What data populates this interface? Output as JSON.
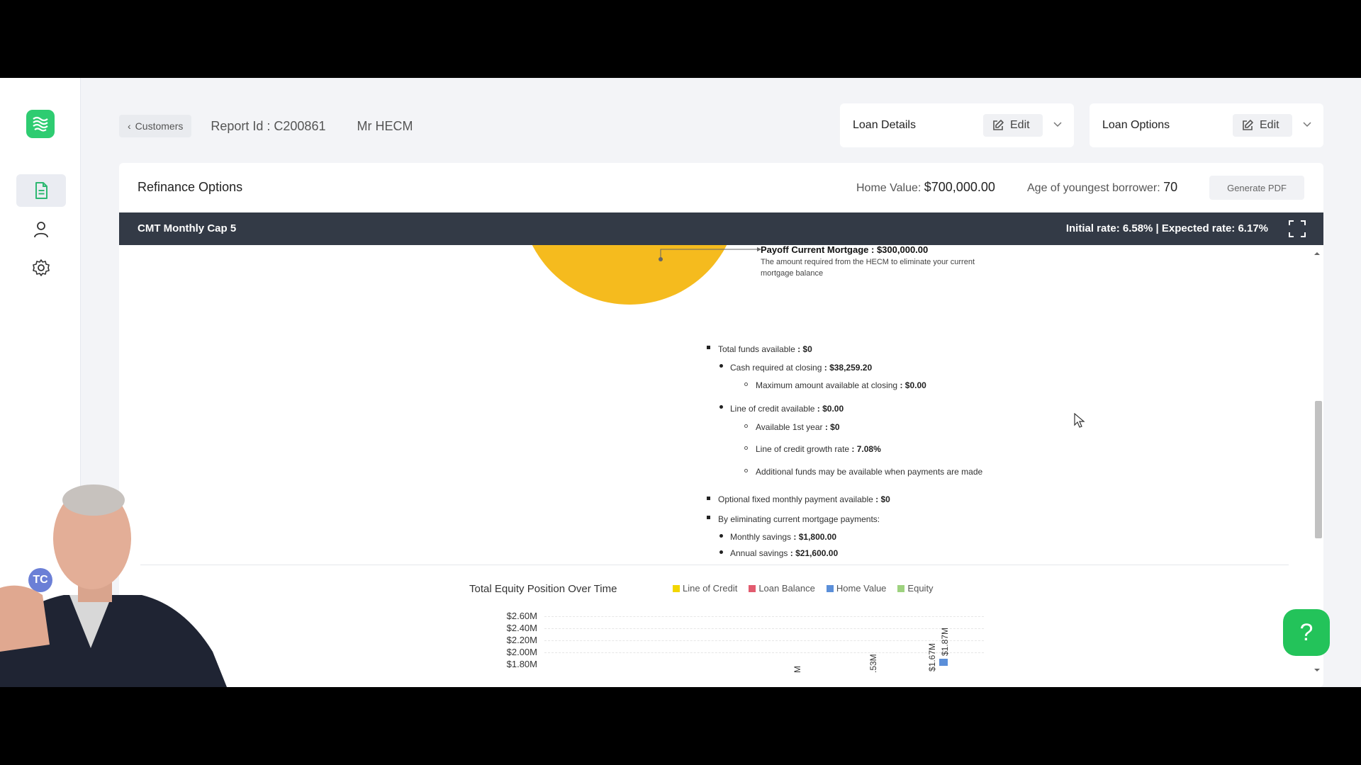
{
  "nav": {
    "back_label": "Customers",
    "report_id": "Report Id : C200861",
    "customer_name": "Mr HECM",
    "user_initials": "TC"
  },
  "loan_details": {
    "title": "Loan Details",
    "edit_label": "Edit"
  },
  "loan_options": {
    "title": "Loan Options",
    "edit_label": "Edit"
  },
  "panel": {
    "title": "Refinance Options",
    "home_value_label": "Home Value:",
    "home_value": "$700,000.00",
    "age_label": "Age of youngest borrower:",
    "age_value": "70",
    "generate_pdf_label": "Generate PDF"
  },
  "strategy": {
    "name": "CMT Monthly Cap 5",
    "rates": "Initial rate: 6.58% | Expected rate: 6.17%"
  },
  "payoff": {
    "label": "Payoff Current Mortgage : $300,000.00",
    "description": "The amount required from the HECM to eliminate your current mortgage balance"
  },
  "details": [
    {
      "label": "Total funds available",
      "value": ": $0"
    },
    {
      "label": "Cash required at closing",
      "value": ": $38,259.20"
    },
    {
      "label": "Maximum amount available at closing",
      "value": ": $0.00"
    },
    {
      "label": "Line of credit available",
      "value": ": $0.00"
    },
    {
      "label": "Available 1st year",
      "value": ": $0"
    },
    {
      "label": "Line of credit growth rate",
      "value": ": 7.08%"
    },
    {
      "label": "Additional funds may be available when payments are made",
      "value": ""
    },
    {
      "label": "Optional fixed monthly payment available",
      "value": ": $0"
    },
    {
      "label": "By eliminating current mortgage payments:",
      "value": ""
    },
    {
      "label": "Monthly savings",
      "value": ": $1,800.00"
    },
    {
      "label": "Annual savings",
      "value": ": $21,600.00"
    }
  ],
  "chart": {
    "title": "Total Equity Position Over Time",
    "legend": [
      {
        "name": "Line of Credit",
        "color": "#f2d600"
      },
      {
        "name": "Loan Balance",
        "color": "#e25b6f"
      },
      {
        "name": "Home Value",
        "color": "#5b8fd9"
      },
      {
        "name": "Equity",
        "color": "#9ed27f"
      }
    ],
    "y_ticks": [
      "$2.60M",
      "$2.40M",
      "$2.20M",
      "$2.00M",
      "$1.80M"
    ],
    "bar_labels": [
      "M",
      ".53M",
      "$1.67M",
      "$1.87M"
    ]
  },
  "colors": {
    "accent_green": "#2ecc71",
    "pie_yellow": "#f5bb1e",
    "strategy_bar": "#333a46"
  }
}
